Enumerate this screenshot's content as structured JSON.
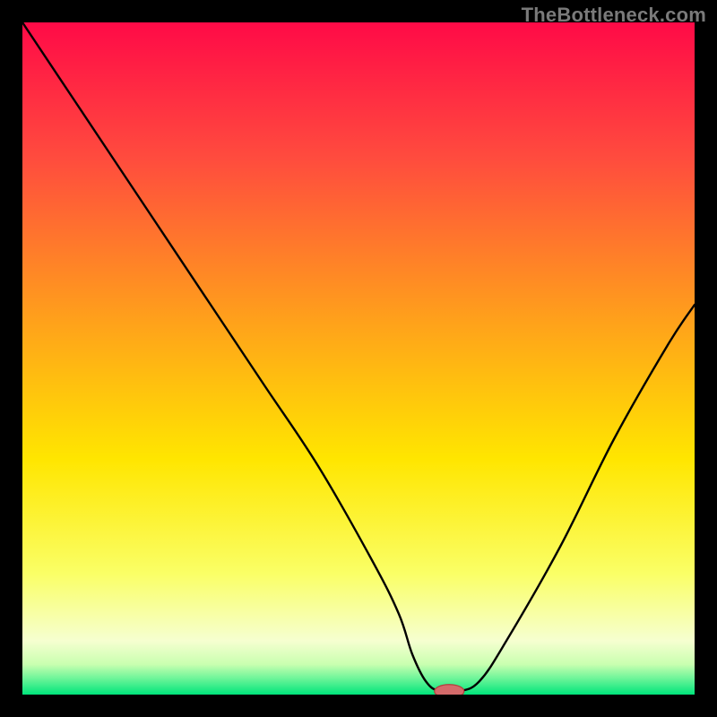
{
  "watermark": "TheBottleneck.com",
  "colors": {
    "frame": "#000000",
    "curve": "#000000",
    "marker_fill": "#d46a6a",
    "marker_stroke": "#b23d3d",
    "gradient_stops": [
      {
        "offset": 0.0,
        "color": "#ff0a47"
      },
      {
        "offset": 0.2,
        "color": "#ff4b3e"
      },
      {
        "offset": 0.45,
        "color": "#ffa31a"
      },
      {
        "offset": 0.65,
        "color": "#ffe600"
      },
      {
        "offset": 0.82,
        "color": "#faff66"
      },
      {
        "offset": 0.92,
        "color": "#f6ffd0"
      },
      {
        "offset": 0.955,
        "color": "#c9ffb0"
      },
      {
        "offset": 0.975,
        "color": "#71f59a"
      },
      {
        "offset": 1.0,
        "color": "#00e57b"
      }
    ]
  },
  "chart_data": {
    "type": "line",
    "title": "",
    "xlabel": "",
    "ylabel": "",
    "xlim": [
      0,
      100
    ],
    "ylim": [
      0,
      100
    ],
    "x": [
      0,
      8,
      16,
      20,
      28,
      36,
      44,
      52,
      56,
      58,
      60,
      62,
      65,
      68,
      72,
      80,
      88,
      96,
      100
    ],
    "values": [
      100,
      88,
      76,
      70,
      58,
      46,
      34,
      20,
      12,
      6,
      2,
      0.5,
      0.5,
      2,
      8,
      22,
      38,
      52,
      58
    ],
    "marker": {
      "x": 63.5,
      "y": 0.5,
      "rx": 2.2,
      "ry": 1.0
    }
  }
}
